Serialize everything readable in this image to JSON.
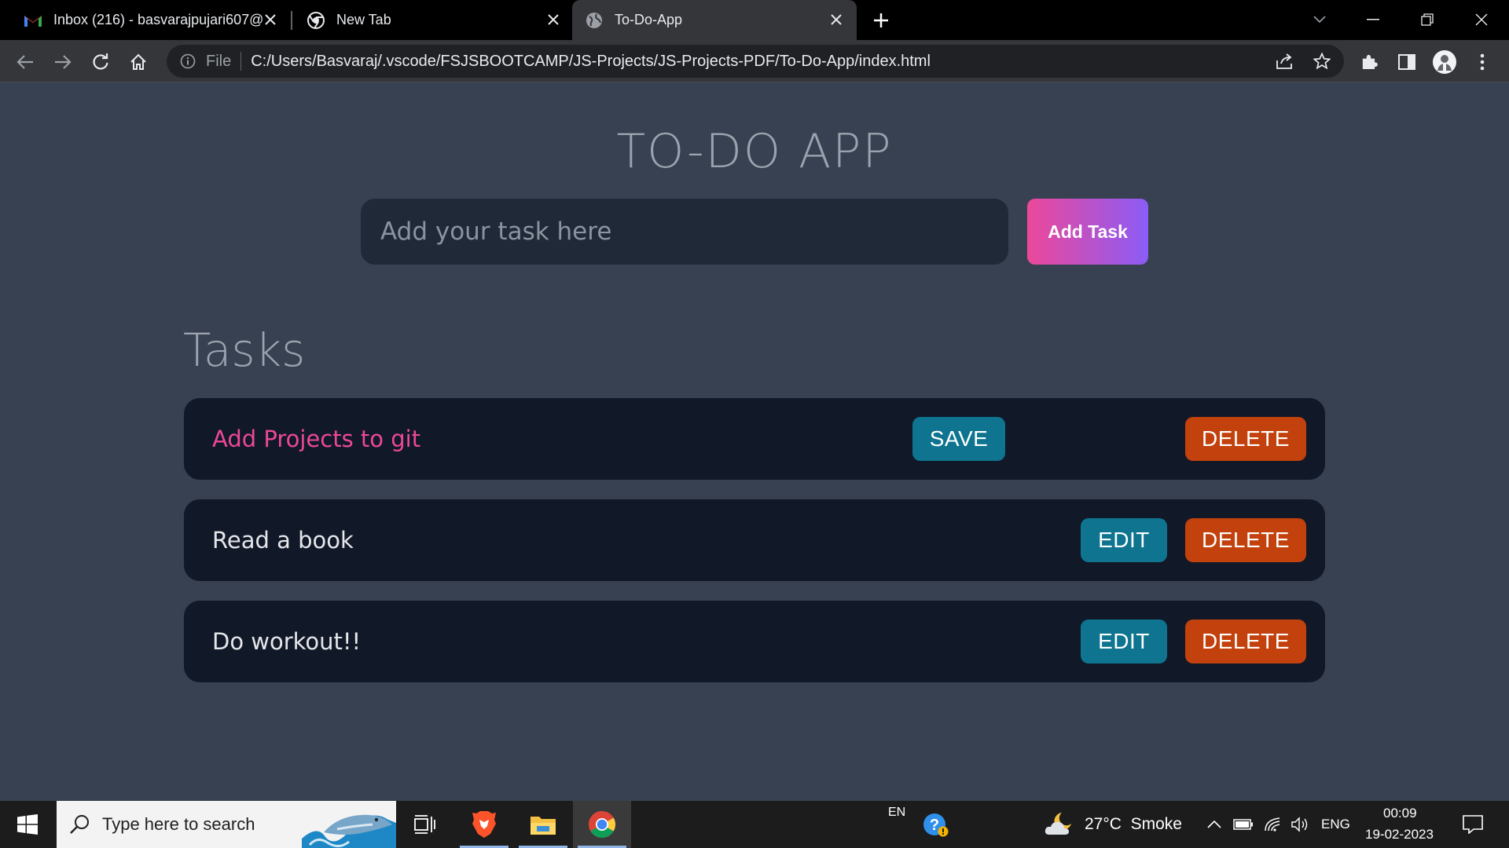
{
  "browser": {
    "tabs": [
      {
        "title": "Inbox (216) - basvarajpujari607@",
        "favicon": "gmail-icon"
      },
      {
        "title": "New Tab",
        "favicon": "chrome-icon"
      },
      {
        "title": "To-Do-App",
        "favicon": "globe-icon",
        "active": true
      }
    ],
    "omnibox": {
      "scheme_label": "File",
      "url": "C:/Users/Basvaraj/.vscode/FSJSBOOTCAMP/JS-Projects/JS-Projects-PDF/To-Do-App/index.html"
    }
  },
  "app": {
    "title": "TO-DO APP",
    "input_placeholder": "Add your task here",
    "add_button": "Add Task",
    "tasks_heading": "Tasks",
    "tasks": [
      {
        "text": "Add Projects to git",
        "action": "SAVE",
        "delete": "DELETE",
        "editing": true
      },
      {
        "text": "Read a book",
        "action": "EDIT",
        "delete": "DELETE",
        "editing": false
      },
      {
        "text": "Do workout!!",
        "action": "EDIT",
        "delete": "DELETE",
        "editing": false
      }
    ],
    "colors": {
      "background": "#374151",
      "card": "#111827",
      "input": "#1f2937",
      "edit_button": "#0e7490",
      "delete_button": "#c2410c",
      "accent_gradient": [
        "#ec4899",
        "#8b5cf6"
      ],
      "editing_text": "#ec4899"
    }
  },
  "taskbar": {
    "search_placeholder": "Type here to search",
    "input_lang": "EN",
    "weather": "27°C  Smoke",
    "lang": "ENG",
    "time": "00:09",
    "date": "19-02-2023"
  }
}
